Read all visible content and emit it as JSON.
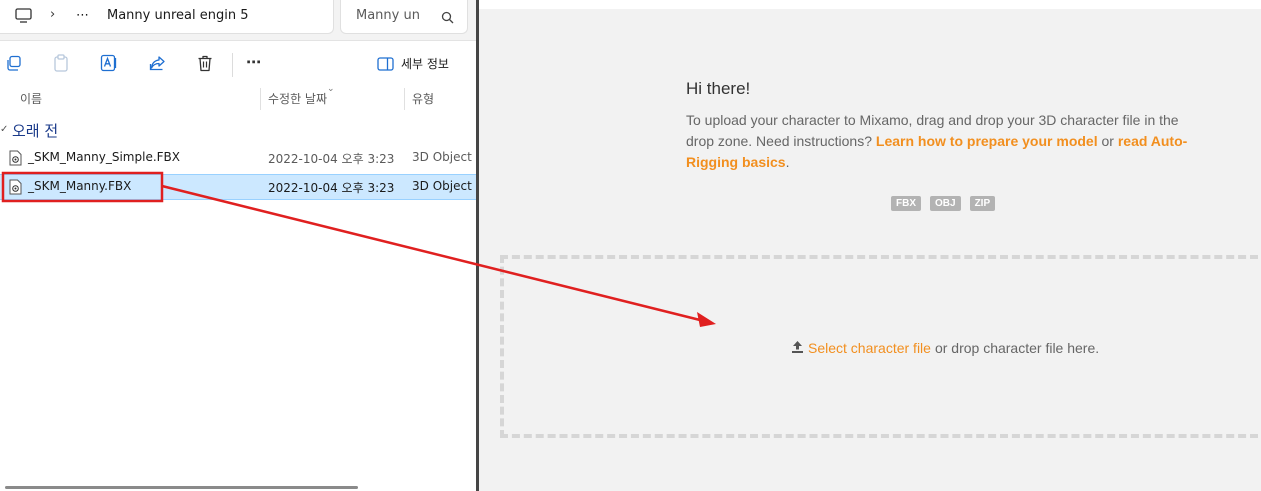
{
  "explorer": {
    "breadcrumb": "Manny unreal engin 5",
    "ellipsis": "⋯",
    "search_text": "Manny un",
    "toolbar": {
      "more": "⋯",
      "details_label": "세부 정보"
    },
    "columns": {
      "name": "이름",
      "modified": "수정한 날짜",
      "type": "유형"
    },
    "group": "오래 전",
    "files": [
      {
        "name": "_SKM_Manny_Simple.FBX",
        "modified": "2022-10-04 오후 3:23",
        "type": "3D Object",
        "selected": false
      },
      {
        "name": "_SKM_Manny.FBX",
        "modified": "2022-10-04 오후 3:23",
        "type": "3D Object",
        "selected": true
      }
    ]
  },
  "mixamo": {
    "greeting": "Hi there!",
    "intro_text": "To upload your character to Mixamo, drag and drop your 3D character file in the drop zone. Need instructions?",
    "link_prepare": "Learn how to prepare your model",
    "or_text": "or",
    "link_basics": "read Auto-Rigging basics",
    "period": ".",
    "formats": [
      "FBX",
      "OBJ",
      "ZIP"
    ],
    "select_link": "Select character file",
    "drop_text": "or drop character file here."
  },
  "colors": {
    "accent_orange": "#f28f1f",
    "annotation_red": "#e02020",
    "selection_blue": "#cce8ff"
  }
}
